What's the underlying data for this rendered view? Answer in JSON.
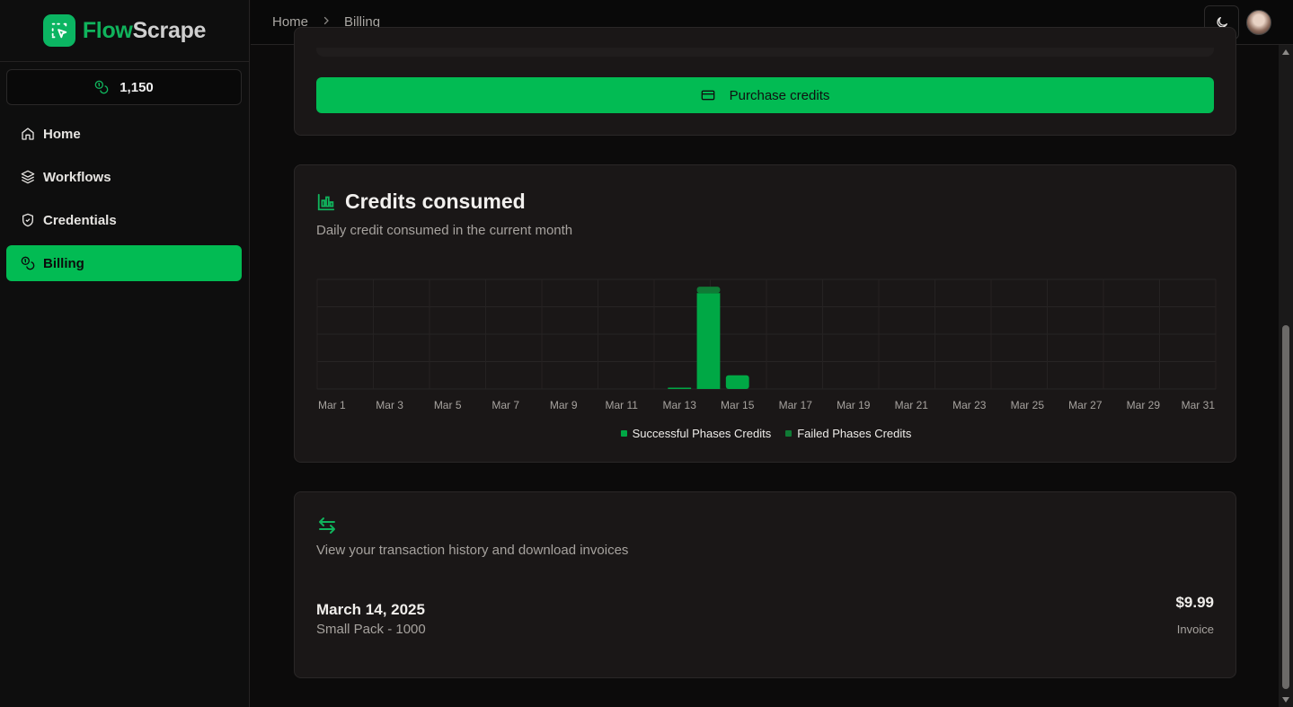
{
  "app": {
    "name_part1": "Flow",
    "name_part2": "Scrape"
  },
  "sidebar": {
    "credits": "1,150",
    "items": [
      {
        "label": "Home",
        "icon": "home-icon",
        "active": false
      },
      {
        "label": "Workflows",
        "icon": "layers-icon",
        "active": false
      },
      {
        "label": "Credentials",
        "icon": "shield-icon",
        "active": false
      },
      {
        "label": "Billing",
        "icon": "coins-icon",
        "active": true
      }
    ]
  },
  "header": {
    "breadcrumbs": [
      "Home",
      "Billing"
    ],
    "theme_icon": "moon-icon",
    "avatar_icon": "user-avatar"
  },
  "purchase": {
    "button_label": "Purchase credits",
    "button_icon": "credit-card-icon"
  },
  "chart_card": {
    "title": "Credits consumed",
    "subtitle": "Daily credit consumed in the current month",
    "icon": "chart-column-icon"
  },
  "chart_data": {
    "type": "bar",
    "stacked": true,
    "categories": [
      "Mar 1",
      "Mar 2",
      "Mar 3",
      "Mar 4",
      "Mar 5",
      "Mar 6",
      "Mar 7",
      "Mar 8",
      "Mar 9",
      "Mar 10",
      "Mar 11",
      "Mar 12",
      "Mar 13",
      "Mar 14",
      "Mar 15",
      "Mar 16",
      "Mar 17",
      "Mar 18",
      "Mar 19",
      "Mar 20",
      "Mar 21",
      "Mar 22",
      "Mar 23",
      "Mar 24",
      "Mar 25",
      "Mar 26",
      "Mar 27",
      "Mar 28",
      "Mar 29",
      "Mar 30",
      "Mar 31"
    ],
    "tick_labels": [
      "Mar 1",
      "Mar 3",
      "Mar 5",
      "Mar 7",
      "Mar 9",
      "Mar 11",
      "Mar 13",
      "Mar 15",
      "Mar 17",
      "Mar 19",
      "Mar 21",
      "Mar 23",
      "Mar 25",
      "Mar 27",
      "Mar 29",
      "Mar 31"
    ],
    "series": [
      {
        "name": "Successful Phases Credits",
        "color": "#00a845",
        "values": [
          0,
          0,
          0,
          0,
          0,
          0,
          0,
          0,
          0,
          0,
          0,
          0,
          1,
          105,
          15,
          0,
          0,
          0,
          0,
          0,
          0,
          0,
          0,
          0,
          0,
          0,
          0,
          0,
          0,
          0,
          0
        ]
      },
      {
        "name": "Failed Phases Credits",
        "color": "#0f7a35",
        "values": [
          0,
          0,
          0,
          0,
          0,
          0,
          0,
          0,
          0,
          0,
          0,
          0,
          0,
          7,
          0,
          0,
          0,
          0,
          0,
          0,
          0,
          0,
          0,
          0,
          0,
          0,
          0,
          0,
          0,
          0,
          0
        ]
      }
    ],
    "ylim": [
      0,
      120
    ],
    "grid": true,
    "legend_position": "bottom"
  },
  "transactions": {
    "icon": "arrows-left-right-icon",
    "subtitle": "View your transaction history and download invoices",
    "items": [
      {
        "date": "March 14, 2025",
        "description": "Small Pack - 1000",
        "amount": "$9.99",
        "link": "Invoice"
      }
    ]
  }
}
